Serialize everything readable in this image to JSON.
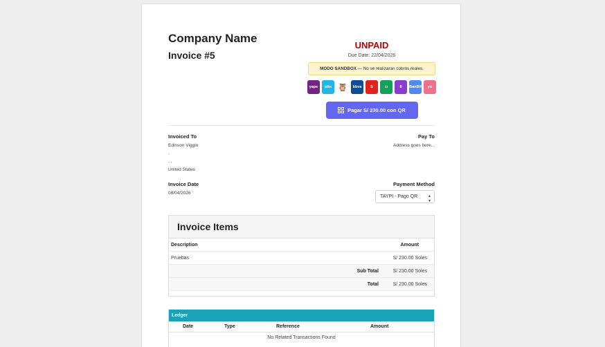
{
  "company_name": "Company Name",
  "invoice_number": "Invoice #5",
  "status": "UNPAID",
  "due_date": "Due Date: 22/04/2026",
  "sandbox": {
    "label": "MODO SANDBOX",
    "message": " — No se realizaran cobros reales."
  },
  "wallets": [
    {
      "name": "Yape",
      "short": "yape",
      "color": "#742484"
    },
    {
      "name": "Plin",
      "short": "plin",
      "color": "#1fb6e8"
    },
    {
      "name": "Tunki",
      "short": "🦉",
      "color": "#ffffff"
    },
    {
      "name": "BBVA",
      "short": "bbva",
      "color": "#0b4e96"
    },
    {
      "name": "Scotiabank",
      "short": "S",
      "color": "#e3231b"
    },
    {
      "name": "Agora",
      "short": "◘",
      "color": "#13a05a"
    },
    {
      "name": "Banco",
      "short": "8",
      "color": "#8a3ccf"
    },
    {
      "name": "BanBif",
      "short": "BanBif",
      "color": "#4d8bf0"
    },
    {
      "name": "Yo",
      "short": "yo",
      "color": "#f16f8a"
    }
  ],
  "qr_button": "Pagar S/ 230.00 con QR",
  "invoiced_to": {
    "label": "Invoiced To",
    "name": "Edinson Viggio",
    "line2": ",",
    "line3": ", ,",
    "country": "United States"
  },
  "pay_to": {
    "label": "Pay To",
    "address": "Address goes here..."
  },
  "invoice_date": {
    "label": "Invoice Date",
    "value": "08/04/2026"
  },
  "payment_method": {
    "label": "Payment Method",
    "selected": "TAYPI - Pago QR"
  },
  "items": {
    "title": "Invoice Items",
    "col_description": "Description",
    "col_amount": "Amount",
    "rows": [
      {
        "description": "Pruebas",
        "amount": "S/ 230.00 Soles"
      }
    ],
    "subtotal_label": "Sub Total",
    "subtotal_value": "S/ 230.00 Soles",
    "total_label": "Total",
    "total_value": "S/ 230.00 Soles"
  },
  "ledger": {
    "title": "Ledger",
    "columns": [
      "Date",
      "Type",
      "Reference",
      "Amount"
    ],
    "empty": "No Related Transactions Found"
  }
}
